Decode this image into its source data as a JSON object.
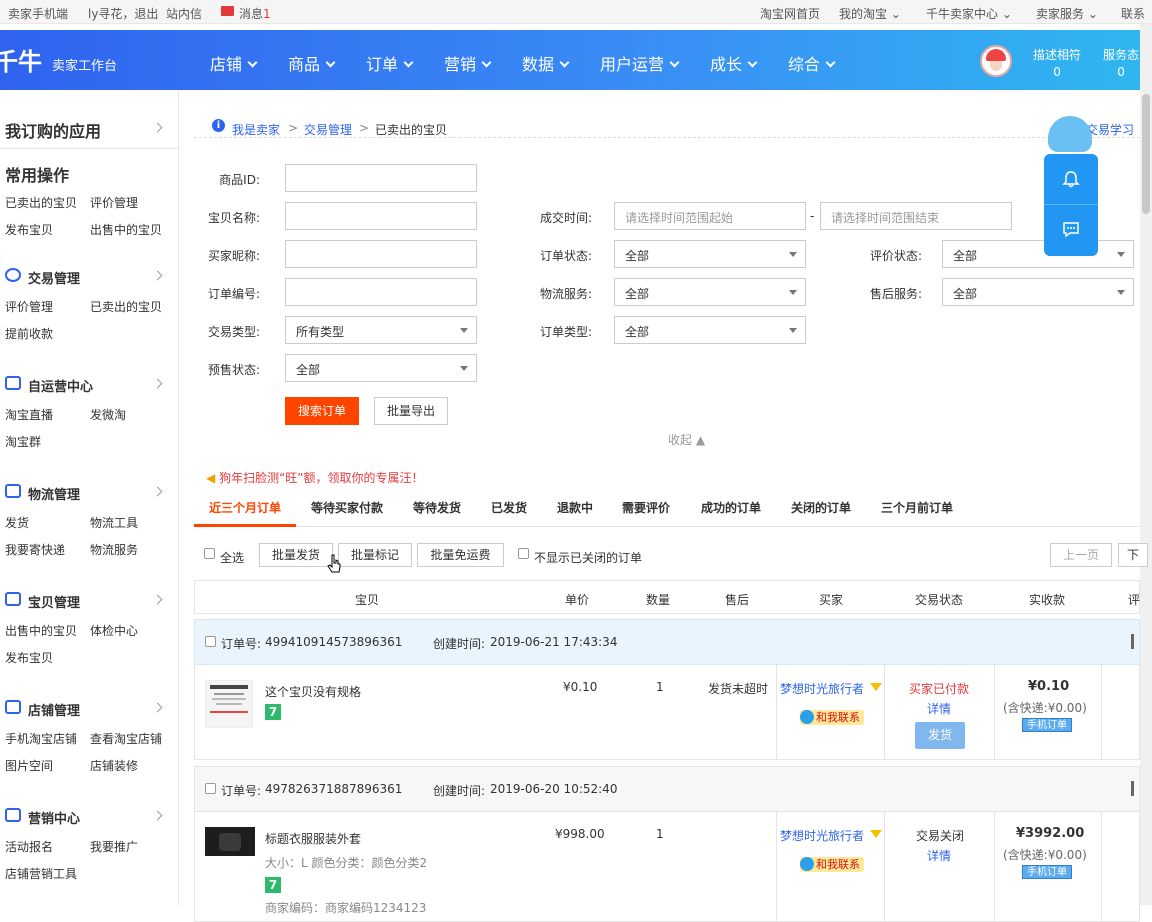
{
  "topbar": {
    "left": [
      "卖家手机端",
      "ly寻花，退出",
      "站内信",
      "消息",
      "1"
    ],
    "right": [
      "淘宝网首页",
      "我的淘宝",
      "千牛卖家中心",
      "卖家服务",
      "联系"
    ]
  },
  "header": {
    "logo": "千牛",
    "subtitle": "卖家工作台",
    "nav": [
      "店铺",
      "商品",
      "订单",
      "营销",
      "数据",
      "用户运营",
      "成长",
      "综合"
    ],
    "stats": [
      {
        "label": "描述相符",
        "value": "0"
      },
      {
        "label": "服务态",
        "value": "0"
      }
    ]
  },
  "sidebar": {
    "my_apps": "我订购的应用",
    "common_ops": "常用操作",
    "common_links": [
      "已卖出的宝贝",
      "评价管理",
      "发布宝贝",
      "出售中的宝贝"
    ],
    "groups": [
      {
        "title": "交易管理",
        "icon": "yen-icon",
        "links": [
          "评价管理",
          "已卖出的宝贝",
          "提前收款"
        ]
      },
      {
        "title": "自运营中心",
        "icon": "chat-icon",
        "links": [
          "淘宝直播",
          "发微淘",
          "淘宝群"
        ]
      },
      {
        "title": "物流管理",
        "icon": "truck-icon",
        "links": [
          "发货",
          "物流工具",
          "我要寄快递",
          "物流服务"
        ]
      },
      {
        "title": "宝贝管理",
        "icon": "bag-icon",
        "links": [
          "出售中的宝贝",
          "体检中心",
          "发布宝贝"
        ]
      },
      {
        "title": "店铺管理",
        "icon": "store-icon",
        "links": [
          "手机淘宝店铺",
          "查看淘宝店铺",
          "图片空间",
          "店铺装修"
        ]
      },
      {
        "title": "营销中心",
        "icon": "megaphone-icon",
        "links": [
          "活动报名",
          "我要推广",
          "店铺营销工具"
        ]
      }
    ]
  },
  "breadcrumb": {
    "items": [
      "我是卖家",
      "交易管理",
      "已卖出的宝贝"
    ],
    "sep": ">",
    "right": "宝交易学习"
  },
  "form": {
    "product_id": "商品ID:",
    "item_name": "宝贝名称:",
    "buyer_nick": "买家昵称:",
    "order_no": "订单编号:",
    "trade_type": "交易类型:",
    "trade_type_val": "所有类型",
    "presale": "预售状态:",
    "presale_val": "全部",
    "deal_time": "成交时间:",
    "time_start_ph": "请选择时间范围起始",
    "time_end_ph": "请选择时间范围结束",
    "dash": "-",
    "order_status": "订单状态:",
    "order_status_val": "全部",
    "logistics": "物流服务:",
    "logistics_val": "全部",
    "order_type": "订单类型:",
    "order_type_val": "全部",
    "review_status": "评价状态:",
    "review_status_val": "全部",
    "after_sale": "售后服务:",
    "after_sale_val": "全部",
    "search_btn": "搜索订单",
    "export_btn": "批量导出",
    "collapse": "收起"
  },
  "promo": "狗年扫脸测“旺”额，领取你的专属汪！",
  "tabs": [
    "近三个月订单",
    "等待买家付款",
    "等待发货",
    "已发货",
    "退款中",
    "需要评价",
    "成功的订单",
    "关闭的订单",
    "三个月前订单"
  ],
  "toolbar": {
    "select_all": "全选",
    "batch_ship": "批量发货",
    "batch_mark": "批量标记",
    "batch_free": "批量免运费",
    "hide_closed": "不显示已关闭的订单",
    "prev": "上一页",
    "next": "下"
  },
  "columns": [
    "宝贝",
    "单价",
    "数量",
    "售后",
    "买家",
    "交易状态",
    "实收款",
    "评"
  ],
  "orders": [
    {
      "order_label": "订单号:",
      "order_no": "499410914573896361",
      "created_label": "创建时间:",
      "created": "2019-06-21 17:43:34",
      "title": "这个宝贝没有规格",
      "badge": "7",
      "price": "¥0.10",
      "qty": "1",
      "after_sale": "发货未超时",
      "buyer": "梦想时光旅行者",
      "contact": "和我联系",
      "status": "买家已付款",
      "detail": "详情",
      "ship_btn": "发货",
      "amount": "¥0.10",
      "shipping": "(含快递:¥0.00)",
      "tag": "手机订单",
      "status_color": "#e4393c"
    },
    {
      "order_label": "订单号:",
      "order_no": "497826371887896361",
      "created_label": "创建时间:",
      "created": "2019-06-20 10:52:40",
      "title": "标题衣服服装外套",
      "spec": "大小：L  颜色分类：颜色分类2",
      "badge": "7",
      "price": "¥998.00",
      "qty": "1",
      "buyer": "梦想时光旅行者",
      "contact": "和我联系",
      "status": "交易关闭",
      "detail": "详情",
      "amount": "¥3992.00",
      "shipping": "(含快递:¥0.00)",
      "tag": "手机订单",
      "status_color": "#333333",
      "extra": "商家编码：商家编码1234123"
    }
  ],
  "colors": {
    "accent": "#ff4400",
    "link": "#2f63ef",
    "header": "#3a8cf5"
  }
}
